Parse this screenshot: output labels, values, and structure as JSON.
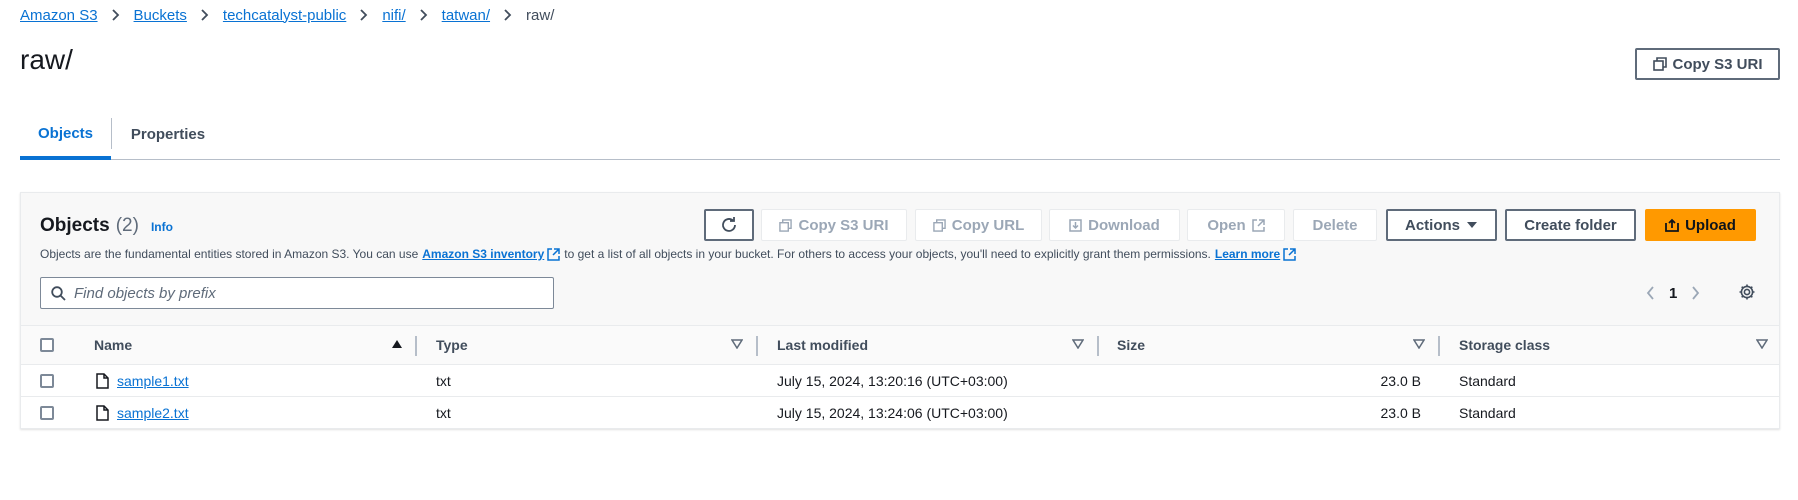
{
  "breadcrumb": {
    "items": [
      "Amazon S3",
      "Buckets",
      "techcatalyst-public",
      "nifi/",
      "tatwan/"
    ],
    "current": "raw/"
  },
  "page": {
    "title": "raw/",
    "copy_s3_uri_label": "Copy S3 URI"
  },
  "tabs": [
    {
      "label": "Objects",
      "active": true
    },
    {
      "label": "Properties",
      "active": false
    }
  ],
  "objects_panel": {
    "title": "Objects",
    "count": "(2)",
    "info_label": "Info",
    "description_before": "Objects are the fundamental entities stored in Amazon S3. You can use",
    "inventory_link": "Amazon S3 inventory",
    "description_after": "to get a list of all objects in your bucket. For others to access your objects, you'll need to explicitly grant them permissions.",
    "learn_more": "Learn more",
    "toolbar": {
      "copy_s3_uri": "Copy S3 URI",
      "copy_url": "Copy URL",
      "download": "Download",
      "open": "Open",
      "delete": "Delete",
      "actions": "Actions",
      "create_folder": "Create folder",
      "upload": "Upload"
    },
    "search_placeholder": "Find objects by prefix",
    "pagination": {
      "current_page": "1"
    }
  },
  "table": {
    "columns": [
      "Name",
      "Type",
      "Last modified",
      "Size",
      "Storage class"
    ],
    "rows": [
      {
        "name": "sample1.txt",
        "type": "txt",
        "last_modified": "July 15, 2024, 13:20:16 (UTC+03:00)",
        "size": "23.0 B",
        "storage_class": "Standard"
      },
      {
        "name": "sample2.txt",
        "type": "txt",
        "last_modified": "July 15, 2024, 13:24:06 (UTC+03:00)",
        "size": "23.0 B",
        "storage_class": "Standard"
      }
    ]
  },
  "colors": {
    "link": "#0972d3",
    "primary_button": "#ff9900",
    "text": "#16191f",
    "disabled": "#9ba7b6"
  },
  "icons": [
    "chevron-right-icon",
    "copy-icon",
    "refresh-icon",
    "download-icon",
    "external-link-icon",
    "caret-down-icon",
    "upload-icon",
    "search-icon",
    "chevron-left-icon",
    "gear-icon",
    "sort-ascending-icon",
    "sort-icon",
    "file-icon"
  ]
}
